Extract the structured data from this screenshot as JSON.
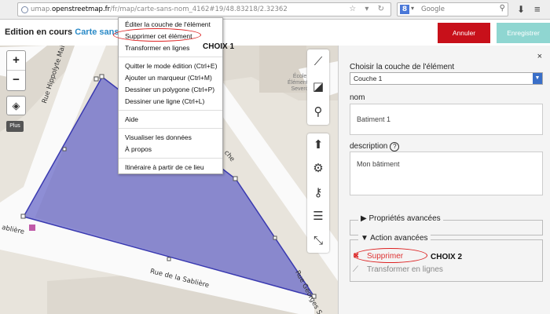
{
  "browser": {
    "url_prefix": "umap.",
    "url_host": "openstreetmap.fr",
    "url_path": "/fr/map/carte-sans-nom_4162#19/48.83218/2.32362",
    "search_engine_letter": "8",
    "search_placeholder": "Google"
  },
  "header": {
    "status": "Edition en cours",
    "map_name": "Carte sans no",
    "cancel_label": "Annuler",
    "save_label": "Enregistrer"
  },
  "map": {
    "zoom_in": "+",
    "zoom_out": "−",
    "plus_label": "Plus",
    "streets": {
      "hippolyte": "Rue Hippolyte Maindron",
      "sabliere_left": "ablière",
      "sabliere_bottom": "Rue de la Sablière",
      "georges": "Rue Georges Sa",
      "cut_che": "che"
    },
    "school": [
      "École",
      "Élémentai",
      "Severo"
    ]
  },
  "context_menu": {
    "items": [
      "Éditer la couche de l'élément",
      "Supprimer cet élément",
      "Transformer en lignes",
      "Quitter le mode édition (Ctrl+E)",
      "Ajouter un marqueur (Ctrl+M)",
      "Dessiner un polygone (Ctrl+P)",
      "Dessiner une ligne (Ctrl+L)",
      "Aide",
      "Visualiser les données",
      "À propos",
      "Itinéraire à partir de ce lieu"
    ]
  },
  "annotations": {
    "choix1": "CHOIX 1",
    "choix2": "CHOIX 2"
  },
  "panel": {
    "close": "×",
    "layer_label": "Choisir la couche de l'élément",
    "layer_value": "Couche 1",
    "name_label": "nom",
    "name_value": "Batiment 1",
    "description_label": "description",
    "help": "?",
    "description_value": "Mon bâtiment",
    "advanced_props": "Propriétés avancées",
    "advanced_actions": "Action avancées",
    "delete_action": "Supprimer",
    "transform_action": "Transformer en lignes"
  },
  "colors": {
    "polygon_fill": "#6a6ac8",
    "polygon_stroke": "#3a3ab0",
    "cancel": "#c8101a",
    "save": "#8fd6d1",
    "link": "#2a8ac7"
  }
}
